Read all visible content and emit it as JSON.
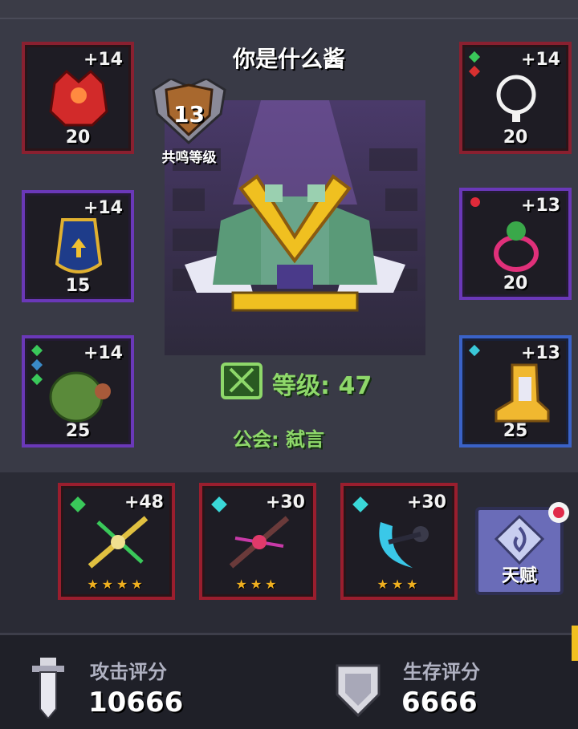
{
  "player": {
    "name": "你是什么酱",
    "resonance_level": "13",
    "resonance_label": "共鸣等级",
    "level_text": "等级: 47",
    "guild_text": "公会: 弑言"
  },
  "left_slots": [
    {
      "plus": "+14",
      "level": "20",
      "icon": "red-helmet-icon"
    },
    {
      "plus": "+14",
      "level": "15",
      "icon": "blue-cape-icon"
    },
    {
      "plus": "+14",
      "level": "25",
      "icon": "green-bush-armor-icon"
    }
  ],
  "right_slots": [
    {
      "plus": "+14",
      "level": "20",
      "icon": "white-necklace-icon"
    },
    {
      "plus": "+13",
      "level": "20",
      "icon": "pink-ring-icon"
    },
    {
      "plus": "+13",
      "level": "25",
      "icon": "golden-boots-icon"
    }
  ],
  "weapons": [
    {
      "plus": "+48",
      "stars": "★★★★",
      "icon": "golden-crossbow-icon"
    },
    {
      "plus": "+30",
      "stars": "★★★",
      "icon": "crimson-bow-icon"
    },
    {
      "plus": "+30",
      "stars": "★★★",
      "icon": "moon-scythe-icon"
    }
  ],
  "talent": {
    "label": "天赋",
    "icon": "talent-crystal-icon"
  },
  "stats": {
    "attack_label": "攻击评分",
    "attack_value": "10666",
    "survival_label": "生存评分",
    "survival_value": "6666"
  },
  "colors": {
    "accent_green": "#8ed86a",
    "frame_red": "#8a2030",
    "frame_purple": "#6a38b8",
    "frame_blue": "#3a62c8"
  }
}
